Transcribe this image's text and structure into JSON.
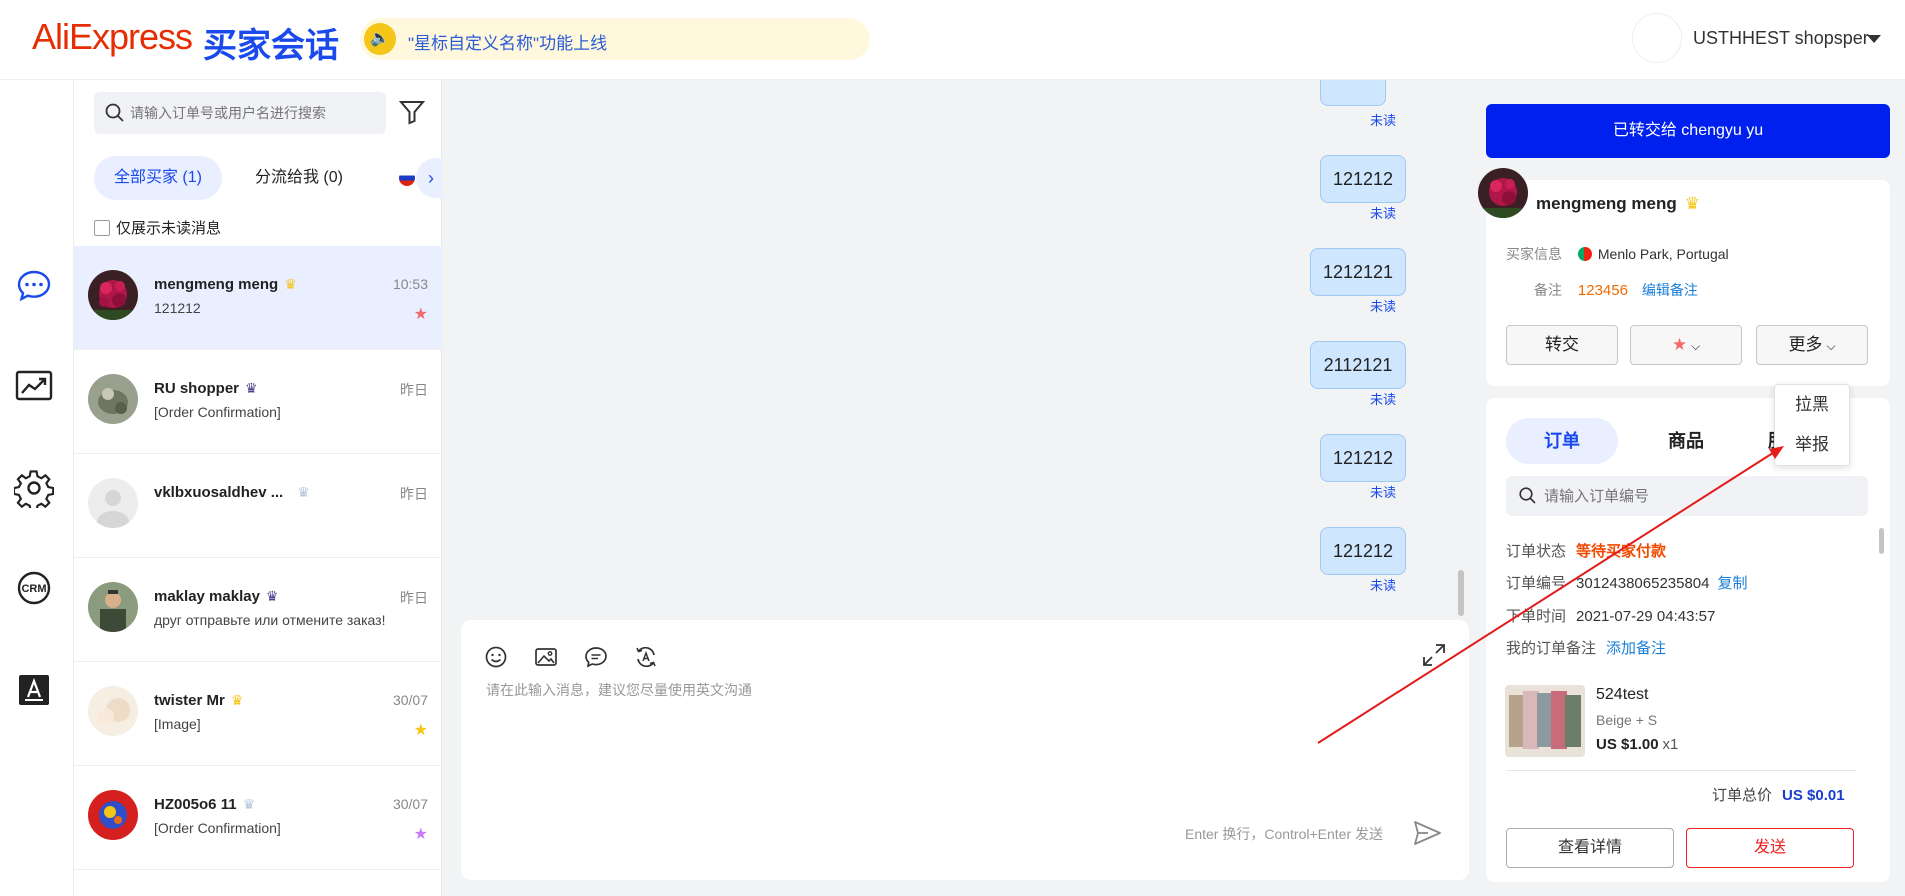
{
  "header": {
    "logo": "AliExpress",
    "logo_sub": "买家会话",
    "notice": "\"星标自定义名称\"功能上线",
    "user_name": "USTHHEST shopsper"
  },
  "sidebar_nav": {
    "icons": [
      "chat-icon",
      "analytics-icon",
      "settings-icon",
      "crm-icon",
      "translate-icon"
    ]
  },
  "conv_list": {
    "search_placeholder": "请输入订单号或用户名进行搜索",
    "tab_all": "全部买家 (1)",
    "tab_distributed": "分流给我 (0)",
    "unread_only": "仅展示未读消息",
    "items": [
      {
        "name": "mengmeng meng",
        "crown": "♛",
        "time": "10:53",
        "preview": "121212",
        "star": "★",
        "star_color": "#f26b6b"
      },
      {
        "name": "RU shopper",
        "crown": "♛",
        "time": "昨日",
        "preview": "[Order Confirmation]",
        "star": "",
        "star_color": ""
      },
      {
        "name": "vklbxuosaldhev ...",
        "crown": "♛",
        "time": "昨日",
        "preview": "",
        "star": "",
        "star_color": ""
      },
      {
        "name": "maklay maklay",
        "crown": "♛",
        "time": "昨日",
        "preview": "друг отправьте или отмените заказ!",
        "star": "",
        "star_color": ""
      },
      {
        "name": "twister Mr",
        "crown": "♛",
        "time": "30/07",
        "preview": "[Image]",
        "star": "★",
        "star_color": "#f5c518"
      },
      {
        "name": "HZ005o6 11",
        "crown": "♛",
        "time": "30/07",
        "preview": "[Order Confirmation]",
        "star": "★",
        "star_color": "#c77dff"
      }
    ]
  },
  "chat": {
    "unread_label": "未读",
    "messages": [
      "121212",
      "1212121",
      "2112121",
      "121212",
      "121212"
    ],
    "input_placeholder": "请在此输入消息，建议您尽量使用英文沟通",
    "send_hint": "Enter 换行，Control+Enter 发送"
  },
  "right_panel": {
    "transfer_banner": "已转交给 chengyu yu",
    "buyer_name": "mengmeng meng",
    "buyer_info_label": "买家信息",
    "buyer_location": "Menlo Park, Portugal",
    "note_label": "备注",
    "note_value": "123456",
    "note_edit": "编辑备注",
    "btn_transfer": "转交",
    "btn_more": "更多",
    "more_menu": [
      "拉黑",
      "举报"
    ],
    "tabs": [
      "订单",
      "商品",
      "服务"
    ],
    "order_search_placeholder": "请输入订单编号",
    "order": {
      "status_label": "订单状态",
      "status": "等待买家付款",
      "no_label": "订单编号",
      "no": "3012438065235804",
      "copy": "复制",
      "time_label": "下单时间",
      "time": "2021-07-29 04:43:57",
      "my_note_label": "我的订单备注",
      "add_note": "添加备注",
      "product_name": "524test",
      "variant": "Beige + S",
      "price": "US $1.00",
      "qty": "x1",
      "total_label": "订单总价",
      "total": "US $0.01",
      "btn_detail": "查看详情",
      "btn_send": "发送"
    }
  }
}
